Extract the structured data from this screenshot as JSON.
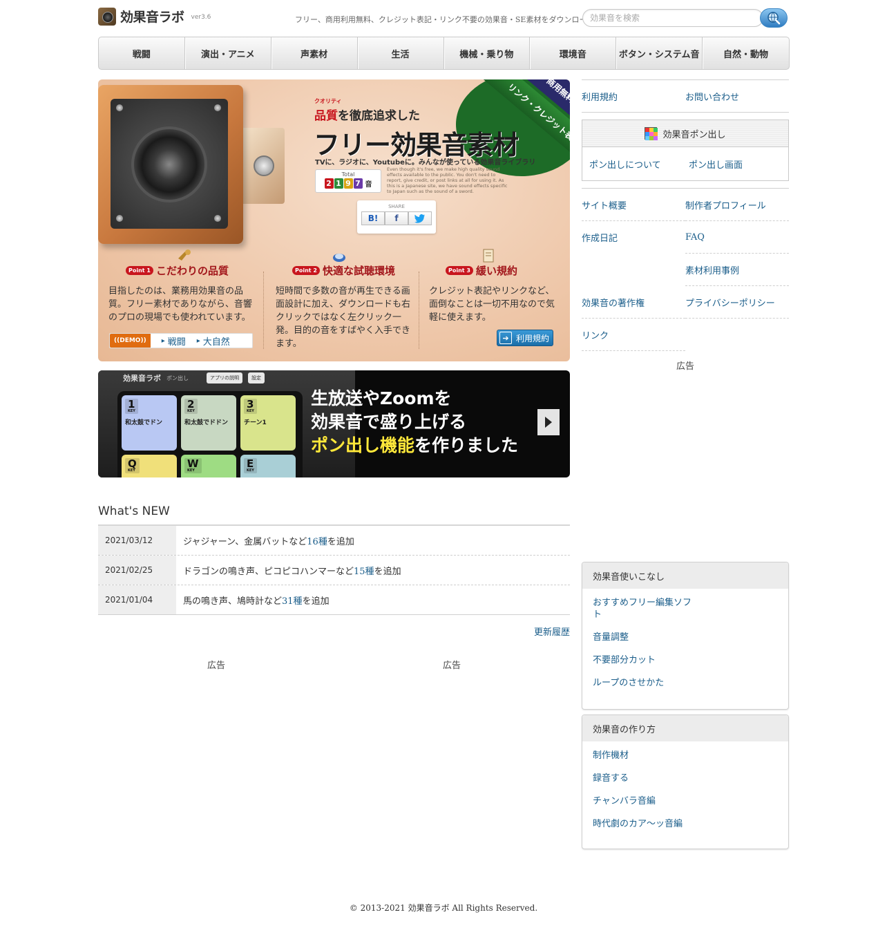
{
  "header": {
    "logo_text": "効果音ラボ",
    "version": "ver3.6",
    "tagline": "フリー、商用利用無料、クレジット表記・リンク不要の効果音・SE素材をダウンロード",
    "search_placeholder": "効果音を検索"
  },
  "nav": {
    "items": [
      {
        "label": "戦闘"
      },
      {
        "label": "演出・アニメ"
      },
      {
        "label": "声素材"
      },
      {
        "label": "生活"
      },
      {
        "label": "機械・乗り物"
      },
      {
        "label": "環境音"
      },
      {
        "label": "ボタン・システム音"
      },
      {
        "label": "自然・動物"
      }
    ]
  },
  "hero": {
    "kicker_ruby": "クオリティ",
    "kicker_red": "品質",
    "kicker_rest": "を徹底追求した",
    "title": "フリー効果音素材",
    "subtitle": "TVに、ラジオに、Youtubeに。みんなが使っている効果音ライブラリ",
    "total_label": "Total",
    "total_digits": [
      "2",
      "1",
      "9",
      "7"
    ],
    "total_unit": "音",
    "english_blurb": "Even though it's free, we make high quality sound effects available to the public. You don't need to report, give credit, or post links at all for using it. As this is a Japanese site, we have sound effects specific to Japan such as the sound of a sword.",
    "share_label": "SHARE",
    "share_buttons": [
      "B!",
      "f",
      "t"
    ],
    "ribbon_top": "商用無料",
    "ribbon_main": "リンク・クレジット表記不要",
    "points": [
      {
        "badge": "Point 1",
        "title": "こだわりの品質",
        "text": "目指したのは、業務用効果音の品質。フリー素材でありながら、音響のプロの現場でも使われています。"
      },
      {
        "badge": "Point 2",
        "title": "快適な試聴環境",
        "text": "短時間で多数の音が再生できる画面設計に加え、ダウンロードも右クリックではなく左クリック一発。目的の音をすばやく入手できます。"
      },
      {
        "badge": "Point 3",
        "title": "緩い規約",
        "text": "クレジット表記やリンクなど、面倒なことは一切不用なので気軽に使えます。"
      }
    ],
    "demo_badge": "((DEMO))",
    "demo_links": [
      "戦闘",
      "大自然"
    ],
    "rules_button": "利用規約"
  },
  "promo": {
    "app_name": "効果音ラボ",
    "app_sub": "ポン出し",
    "chip_help": "アプリの説明",
    "chip_settings": "設定",
    "pads": [
      {
        "key": "1",
        "label": "和太鼓でドン",
        "color": "#b9c8f3"
      },
      {
        "key": "2",
        "label": "和太鼓でドドン",
        "color": "#c8d8c2"
      },
      {
        "key": "3",
        "label": "チーン1",
        "color": "#d9e48c"
      },
      {
        "key": "Q",
        "label": "",
        "color": "#f0e07a"
      },
      {
        "key": "W",
        "label": "",
        "color": "#9edc83"
      },
      {
        "key": "E",
        "label": "",
        "color": "#a9cfd6"
      }
    ],
    "pad_key_word": "KEY",
    "line1": "生放送やZoomを",
    "line2": "効果音で盛り上げる",
    "line3_highlight": "ポン出し機能",
    "line3_rest": "を作りました"
  },
  "news": {
    "title": "What's NEW",
    "rows": [
      {
        "date": "2021/03/12",
        "pre": "ジャジャーン、金属バットなど",
        "link": "16種",
        "post": "を追加"
      },
      {
        "date": "2021/02/25",
        "pre": "ドラゴンの鳴き声、ピコピコハンマーなど",
        "link": "15種",
        "post": "を追加"
      },
      {
        "date": "2021/01/04",
        "pre": "馬の鳴き声、鳩時計など",
        "link": "31種",
        "post": "を追加"
      }
    ],
    "more": "更新履歴"
  },
  "ads": {
    "label": "広告"
  },
  "sidebar": {
    "top_links": [
      "利用規約",
      "お問い合わせ"
    ],
    "pon_title": "効果音ポン出し",
    "pon_links": [
      "ポン出しについて",
      "ポン出し画面"
    ],
    "grid": [
      [
        "サイト概要",
        "制作者プロフィール"
      ],
      [
        "作成日記",
        "FAQ"
      ],
      [
        "",
        "素材利用事例"
      ],
      [
        "効果音の著作権",
        "プライバシーポリシー"
      ],
      [
        "リンク",
        ""
      ]
    ],
    "panel1": {
      "title": "効果音使いこなし",
      "links": [
        "おすすめフリー編集ソフト",
        "音量調整",
        "不要部分カット",
        "ループのさせかた"
      ]
    },
    "panel2": {
      "title": "効果音の作り方",
      "links": [
        "制作機材",
        "録音する",
        "チャンバラ音編",
        "時代劇のカア～ッ音編"
      ]
    }
  },
  "footer": {
    "copyright": "© 2013-2021 効果音ラボ All Rights Reserved."
  }
}
